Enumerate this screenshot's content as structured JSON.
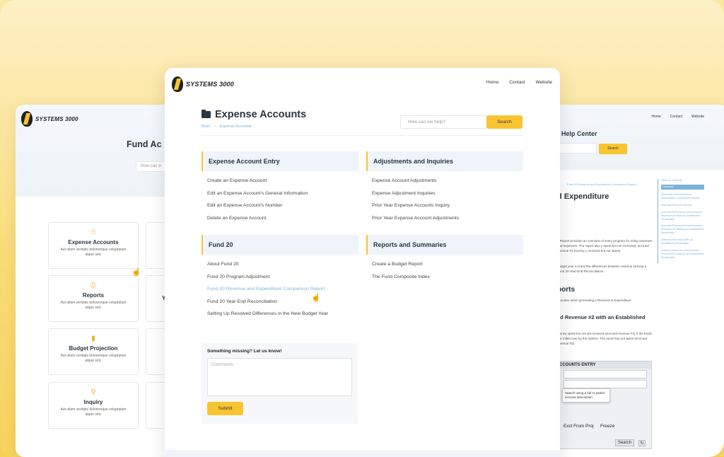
{
  "brand": {
    "name": "SYSTEMS 3000"
  },
  "colors": {
    "accent": "#f8c531",
    "link": "#7ab3d9",
    "heading": "#2b3642"
  },
  "main": {
    "nav": [
      "Home",
      "Contact",
      "Website"
    ],
    "title": "Expense Accounts",
    "breadcrumb": [
      "Main",
      "Expense Accounts"
    ],
    "search": {
      "placeholder": "How can we help?",
      "button": "Search"
    },
    "sections": [
      {
        "title": "Expense Account Entry",
        "items": [
          "Create an Expense Account",
          "Edit an Expense Account's General Information",
          "Edit an Expense Account's Number",
          "Delete an Expense Account"
        ]
      },
      {
        "title": "Adjustments and Inquiries",
        "items": [
          "Expense Account Adjustments",
          "Expense Adjustment Inquiries",
          "Prior Year Expense Accounts Inquiry",
          "Prior Year Expense Account Adjustments"
        ]
      },
      {
        "title": "Fund 20",
        "items": [
          "About Fund 20",
          "Fund 20 Program Adjustment",
          "Fund 20 Revenue and Expenditure Comparison Report",
          "Fund 20 Year-End Reconciliation",
          "Setting Up Resolved Differences in the New Budget Year"
        ]
      },
      {
        "title": "Reports and Summaries",
        "items": [
          "Create a Budget Report",
          "The Fund Composite Index"
        ]
      }
    ],
    "feedback": {
      "heading": "Something missing? Let us know!",
      "placeholder": "Comments",
      "button": "Submit"
    }
  },
  "left": {
    "title_partial": "Fund Ac",
    "search_partial": "How can w",
    "cards": [
      {
        "icon": "dollar-icon",
        "title": "Expense Accounts",
        "desc": "Aut ullam veritatis doloremque voluptatum atque sint."
      },
      {
        "icon": "printer-icon",
        "title": "Reports",
        "desc": "Aut ullam veritatis doloremque voluptatum atque sint."
      },
      {
        "icon": "chart-icon",
        "title": "Budget Projection",
        "desc": "Aut ullam veritatis doloremque voluptatum atque sint."
      },
      {
        "icon": "magnifier-icon",
        "title": "Inquiry",
        "desc": "Aut ullam veritatis doloremque voluptatum atque sint."
      }
    ],
    "partial_card_letter": "Y"
  },
  "right": {
    "nav": [
      "Home",
      "Contact",
      "Website"
    ],
    "help_center": "g Help Center",
    "search_button": "Search",
    "breadcrumb": "Fund 20 Revenue and Expenditure Comparison Report",
    "heading": "d Expenditure",
    "para1": "n Report provides an overview of every program for nding revenues and expenses. The report also y spent but not received), accrued revenue #2 (money y received but not spent).",
    "para2": "budget year to track the differences between revenue forming a Fund 20 Year-End Reconciliation.",
    "h_reports": "ports",
    "para3": "ncounter when generating a Revenue & Expenditure",
    "h_accrued": "ed Revenue #2 with an Established",
    "para4": "money spent but not yet received (accrued revenue #1) h the funds are rolled over by the system. The report but not spent (accrued revenue #2).",
    "toc": {
      "title": "Table of Contents",
      "items": [
        "Overview",
        "Generate a Revenue and Expenditure Comparison Report",
        "Example Fund 20 Reports",
        "Accrued Revenue #1 and Accrued Revenue #2 With an Established Receivable",
        "Accrued Revenue #1 and Accrued Revenue #2 Without an Established Receivable",
        "Deferred Revenue With an Established Receivable",
        "Deferred Revenue and Accrued Revenue #2 Without an Established Receivable"
      ]
    },
    "screenshot": {
      "title": "CCOUNTS ENTRY",
      "tooltip": "Search using a full or partial account description.",
      "excl": "Excl From Proj",
      "freeze": "Freeze",
      "search": "Search"
    }
  }
}
